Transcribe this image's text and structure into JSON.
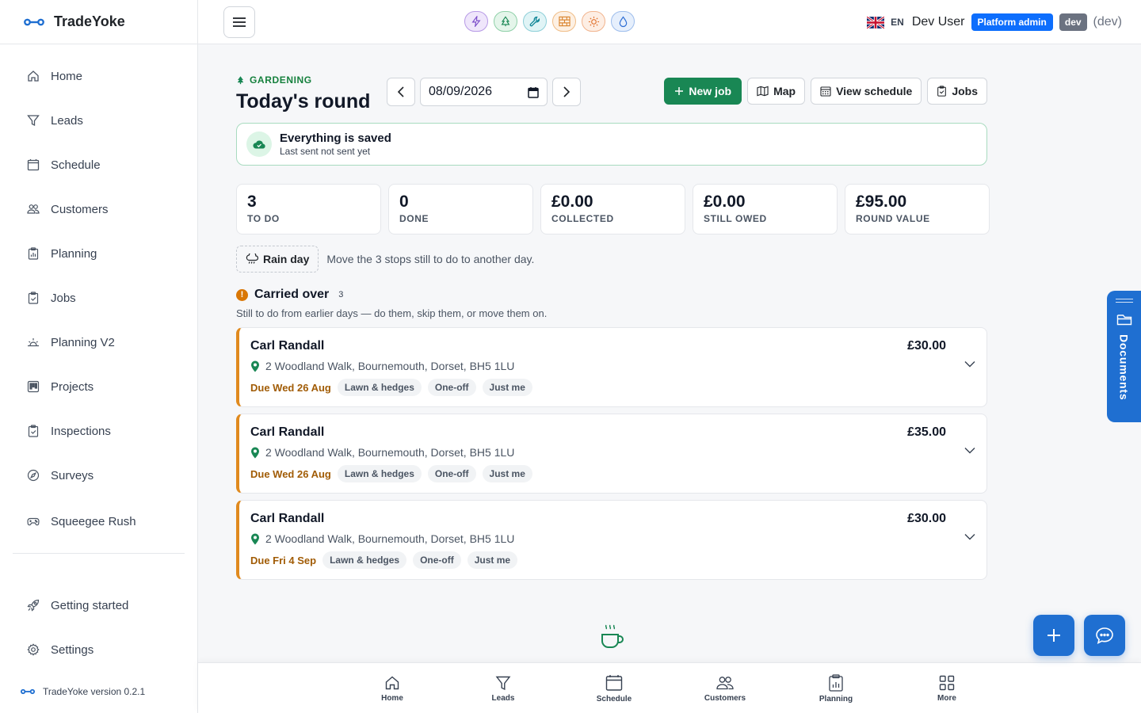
{
  "app": {
    "name": "TradeYoke",
    "version_text": "TradeYoke version 0.2.1"
  },
  "sidebar": {
    "items": [
      {
        "label": "Home",
        "icon": "home-icon"
      },
      {
        "label": "Leads",
        "icon": "funnel-icon"
      },
      {
        "label": "Schedule",
        "icon": "calendar-icon"
      },
      {
        "label": "Customers",
        "icon": "people-icon"
      },
      {
        "label": "Planning",
        "icon": "clipboard-chart-icon"
      },
      {
        "label": "Jobs",
        "icon": "clipboard-check-icon"
      },
      {
        "label": "Planning V2",
        "icon": "sunrise-icon"
      },
      {
        "label": "Projects",
        "icon": "kanban-icon"
      },
      {
        "label": "Inspections",
        "icon": "clipboard-check-icon"
      },
      {
        "label": "Surveys",
        "icon": "compass-icon"
      },
      {
        "label": "Squeegee Rush",
        "icon": "controller-icon"
      }
    ],
    "bottom_items": [
      {
        "label": "Getting started",
        "icon": "rocket-icon"
      },
      {
        "label": "Settings",
        "icon": "gear-icon"
      }
    ]
  },
  "topbar": {
    "trade_icons": [
      {
        "name": "lightning-trade-icon",
        "bg": "#efe6fb",
        "border": "#b79ae6",
        "color": "#7b4cc9"
      },
      {
        "name": "tree-trade-icon",
        "bg": "#e4f5ea",
        "border": "#8fd0a8",
        "color": "#198754"
      },
      {
        "name": "wrench-trade-icon",
        "bg": "#e0f4f6",
        "border": "#8dcfd8",
        "color": "#0f8596"
      },
      {
        "name": "bricks-trade-icon",
        "bg": "#fdf0e3",
        "border": "#f0bd87",
        "color": "#d9822b"
      },
      {
        "name": "sun-trade-icon",
        "bg": "#fdeee4",
        "border": "#f1b48e",
        "color": "#e0702a"
      },
      {
        "name": "droplet-trade-icon",
        "bg": "#e6effc",
        "border": "#9dbdec",
        "color": "#2f6fd4"
      }
    ],
    "lang": "EN",
    "user": "Dev User",
    "role_badge": "Platform admin",
    "env_badge": "dev",
    "env_text": "(dev)"
  },
  "page": {
    "eyebrow": "GARDENING",
    "title": "Today's round",
    "date_value": "08/09/2026",
    "actions": {
      "new_job": "New job",
      "map": "Map",
      "view_schedule": "View schedule",
      "jobs": "Jobs"
    },
    "save_status": {
      "title": "Everything is saved",
      "subtitle": "Last sent not sent yet"
    },
    "stats": [
      {
        "value": "3",
        "label": "TO DO"
      },
      {
        "value": "0",
        "label": "DONE"
      },
      {
        "value": "£0.00",
        "label": "COLLECTED"
      },
      {
        "value": "£0.00",
        "label": "STILL OWED"
      },
      {
        "value": "£95.00",
        "label": "ROUND VALUE"
      }
    ],
    "rain_day": {
      "label": "Rain day",
      "text": "Move the 3 stops still to do to another day."
    },
    "carried_over": {
      "title": "Carried over",
      "count": "3",
      "subtitle": "Still to do from earlier days — do them, skip them, or move them on.",
      "jobs": [
        {
          "customer": "Carl Randall",
          "price": "£30.00",
          "address": "2 Woodland Walk, Bournemouth, Dorset, BH5 1LU",
          "due": "Due Wed 26 Aug",
          "tags": [
            "Lawn & hedges",
            "One-off",
            "Just me"
          ]
        },
        {
          "customer": "Carl Randall",
          "price": "£35.00",
          "address": "2 Woodland Walk, Bournemouth, Dorset, BH5 1LU",
          "due": "Due Wed 26 Aug",
          "tags": [
            "Lawn & hedges",
            "One-off",
            "Just me"
          ]
        },
        {
          "customer": "Carl Randall",
          "price": "£30.00",
          "address": "2 Woodland Walk, Bournemouth, Dorset, BH5 1LU",
          "due": "Due Fri 4 Sep",
          "tags": [
            "Lawn & hedges",
            "One-off",
            "Just me"
          ]
        }
      ]
    }
  },
  "tabbar": [
    {
      "label": "Home",
      "icon": "home-icon"
    },
    {
      "label": "Leads",
      "icon": "funnel-icon"
    },
    {
      "label": "Schedule",
      "icon": "calendar-icon"
    },
    {
      "label": "Customers",
      "icon": "people-icon"
    },
    {
      "label": "Planning",
      "icon": "clipboard-chart-icon"
    },
    {
      "label": "More",
      "icon": "grid-icon"
    }
  ],
  "floating": {
    "documents_label": "Documents"
  },
  "colors": {
    "accent": "#1f6fd1",
    "success": "#198754",
    "warning": "#d97706",
    "due": "#a15c06"
  }
}
